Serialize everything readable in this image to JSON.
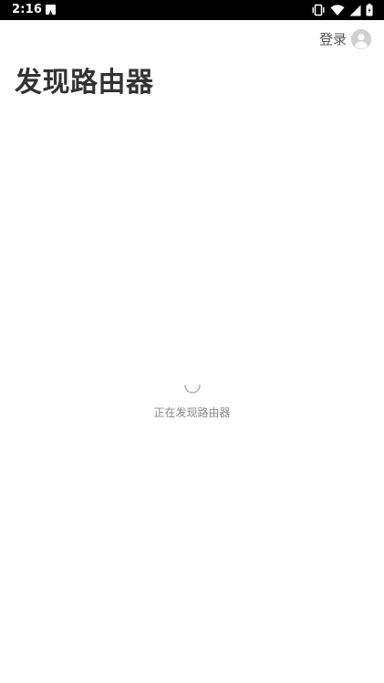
{
  "status_bar": {
    "time": "2:16",
    "icons": [
      "notification-a-icon",
      "vibrate-icon",
      "wifi-icon",
      "cell-signal-icon",
      "battery-icon"
    ]
  },
  "header": {
    "login_label": "登录",
    "avatar_icon": "user-avatar-icon"
  },
  "main": {
    "title": "发现路由器",
    "loading_text": "正在发现路由器"
  },
  "colors": {
    "title": "#333333",
    "login_text": "#555555",
    "loading_text": "#8a8a8a",
    "avatar_bg": "#cfcfcf",
    "status_bar_bg": "#000000"
  }
}
